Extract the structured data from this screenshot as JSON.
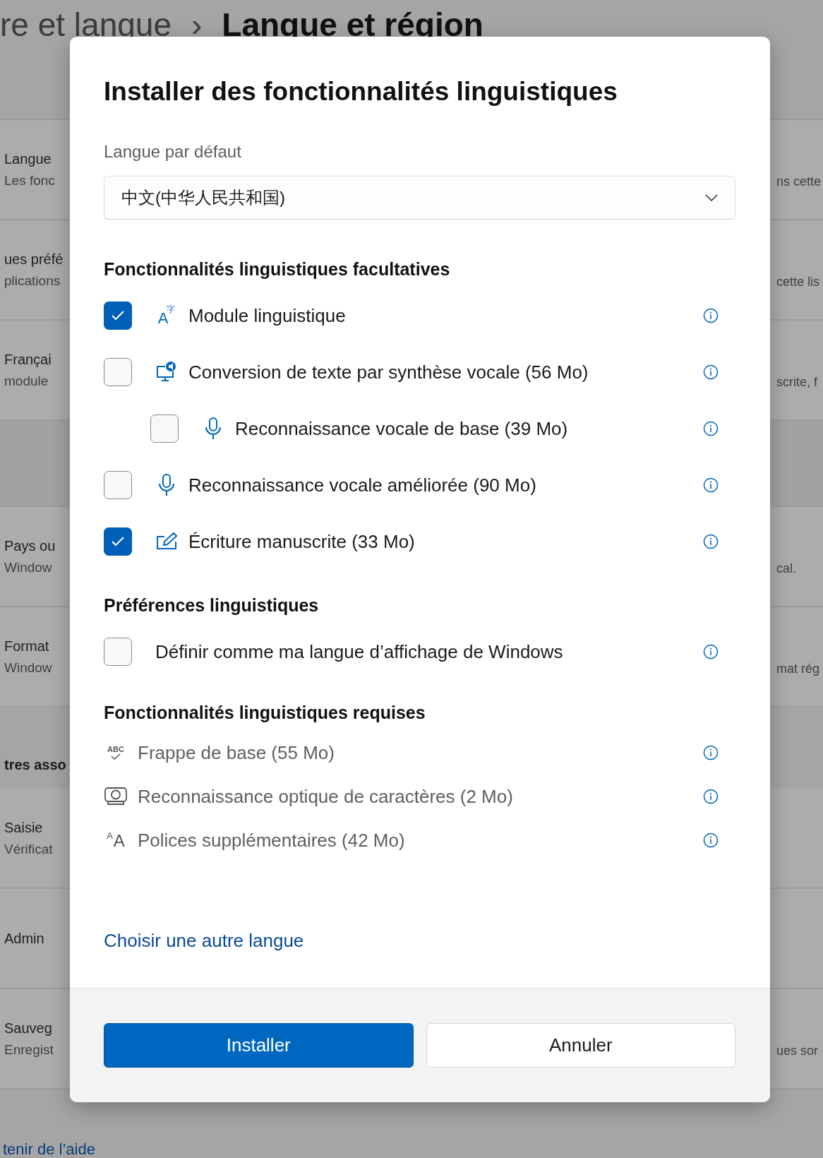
{
  "breadcrumb": [
    {
      "text": "re et langue",
      "current": false
    },
    {
      "text": "›",
      "current": false
    },
    {
      "text": "Langue et région",
      "current": true
    }
  ],
  "settings_rows": [
    {
      "kind": "row",
      "title": "Langue",
      "subtitle": "Les fonc",
      "trailing": "ns cette"
    },
    {
      "kind": "row",
      "title": "ues préfé",
      "subtitle": "plications",
      "trailing": "cette lis"
    },
    {
      "kind": "row",
      "title": "Françai",
      "subtitle": "module",
      "trailing": "scrite, f"
    },
    {
      "kind": "blank"
    },
    {
      "kind": "row",
      "title": "Pays ou",
      "subtitle": "Window",
      "trailing": "cal."
    },
    {
      "kind": "row",
      "title": "Format",
      "subtitle": "Window",
      "trailing": "mat rég"
    },
    {
      "kind": "heading",
      "title": "tres asso"
    },
    {
      "kind": "row",
      "title": "Saisie",
      "subtitle": "Vérificat"
    },
    {
      "kind": "row",
      "title": "Admin"
    },
    {
      "kind": "row",
      "title": "Sauveg",
      "subtitle": "Enregist",
      "trailing": "ues sor"
    }
  ],
  "help_link": "tenir de l’aide",
  "dialog": {
    "title": "Installer des fonctionnalités linguistiques",
    "default_language_label": "Langue par défaut",
    "default_language": "中文(中华人民共和国)",
    "sections": [
      {
        "heading": "Fonctionnalités linguistiques facultatives",
        "items": [
          {
            "label": "Module linguistique",
            "checked": true,
            "kind": "language",
            "glyph": [
              "A",
              "字"
            ]
          },
          {
            "label": "Conversion de texte par synthèse vocale (56 Mo)",
            "checked": false,
            "kind": "speech",
            "children": [
              {
                "label": "Reconnaissance vocale de base (39 Mo)",
                "checked": false,
                "kind": "mic"
              }
            ]
          },
          {
            "label": "Reconnaissance vocale améliorée (90 Mo)",
            "checked": false,
            "kind": "mic"
          },
          {
            "label": "Écriture manuscrite (33 Mo)",
            "checked": true,
            "kind": "pen"
          }
        ]
      },
      {
        "heading": "Préférences linguistiques",
        "items": [
          {
            "label": "Définir comme ma langue d’affichage de Windows",
            "checked": false
          }
        ]
      }
    ],
    "required": {
      "heading": "Fonctionnalités linguistiques requises",
      "items": [
        {
          "label": "Frappe de base (55 Mo)",
          "kind": "abc",
          "glyph": [
            "ABC"
          ]
        },
        {
          "label": "Reconnaissance optique de caractères (2 Mo)",
          "kind": "camera"
        },
        {
          "label": "Polices supplémentaires (42 Mo)",
          "kind": "fonts",
          "glyph": [
            "A",
            "A"
          ]
        }
      ]
    },
    "link": "Choisir une autre langue",
    "buttons": [
      {
        "label": "Installer",
        "kind": "primary"
      },
      {
        "label": "Annuler",
        "kind": "secondary"
      }
    ]
  }
}
